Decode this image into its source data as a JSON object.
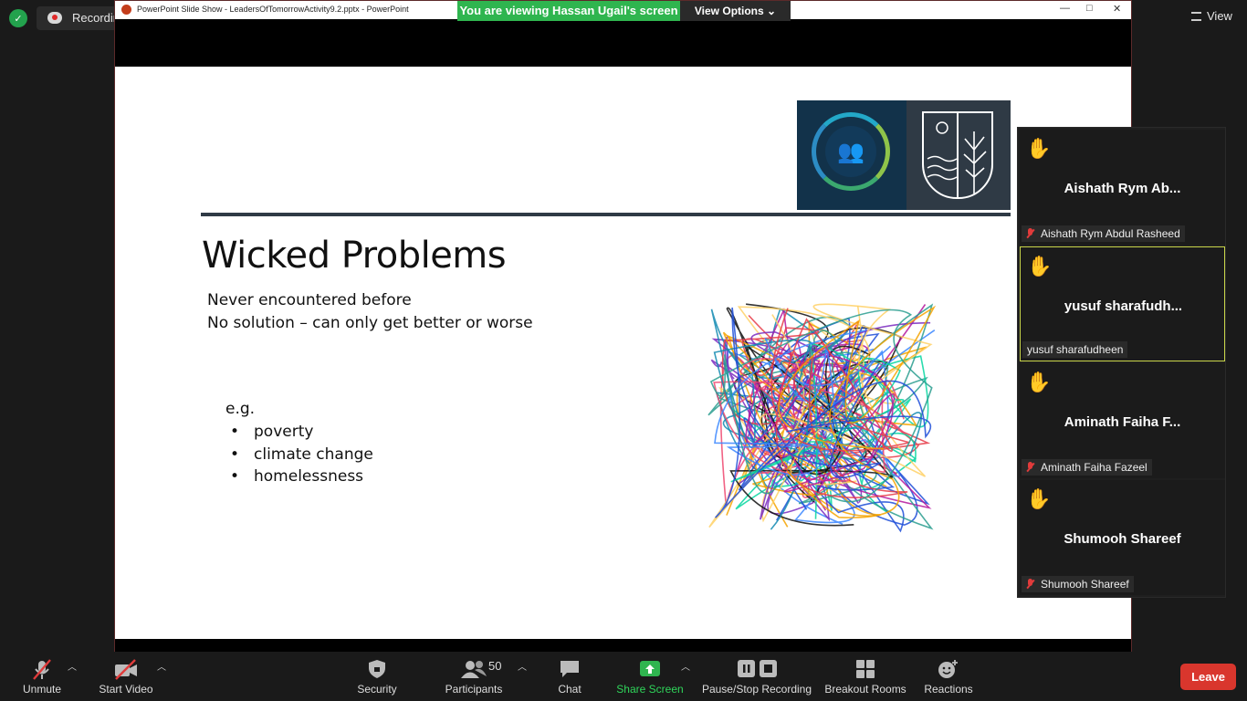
{
  "topbar": {
    "recording_label": "Recording...",
    "view_label": "View"
  },
  "share": {
    "window_title": "PowerPoint Slide Show  -  LeadersOfTomorrowActivity9.2.pptx - PowerPoint",
    "banner_text": "You are viewing Hassan Ugail's screen",
    "view_options_label": "View Options"
  },
  "slide": {
    "title": "Wicked Problems",
    "lines": [
      "Never encountered before",
      "No solution – can only get better or worse"
    ],
    "eg_label": "e.g.",
    "bullets": [
      "poverty",
      "climate change",
      "homelessness"
    ]
  },
  "participants_panel": [
    {
      "display": "Aishath Rym Ab...",
      "name": "Aishath Rym Abdul Rasheed",
      "muted": true,
      "hand_color": "#f2c9a5"
    },
    {
      "display": "yusuf  sharafudh...",
      "name": "yusuf sharafudheen",
      "muted": false,
      "hand_color": "#f2c9a5"
    },
    {
      "display": "Aminath Faiha F...",
      "name": "Aminath Faiha Fazeel",
      "muted": true,
      "hand_color": "#f5c518"
    },
    {
      "display": "Shumooh Shareef",
      "name": "Shumooh Shareef",
      "muted": true,
      "hand_color": "#f5c518"
    }
  ],
  "toolbar": {
    "unmute": "Unmute",
    "start_video": "Start Video",
    "security": "Security",
    "participants": "Participants",
    "participants_count": "50",
    "chat": "Chat",
    "share_screen": "Share Screen",
    "pause_stop_recording": "Pause/Stop Recording",
    "breakout_rooms": "Breakout Rooms",
    "reactions": "Reactions",
    "leave": "Leave"
  },
  "colors": {
    "share_green": "#2fb54f",
    "leave_red": "#d9362d",
    "active_speaker": "#c9d64a"
  }
}
